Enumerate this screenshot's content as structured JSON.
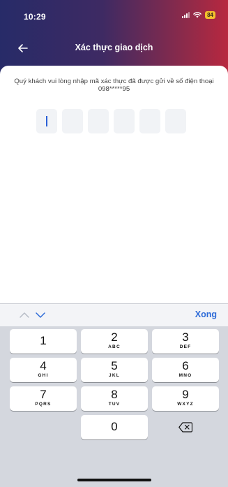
{
  "status_bar": {
    "time": "10:29",
    "battery": "84",
    "signal_icon": "signal-bars-icon",
    "wifi_icon": "wifi-icon"
  },
  "nav": {
    "title": "Xác thực giao dịch",
    "back_icon": "arrow-left-icon"
  },
  "otp": {
    "message": "Quý khách vui lòng nhập mã xác thực đã được gửi về số điện thoại 098*****95",
    "length": 6,
    "digits": [
      "",
      "",
      "",
      "",
      "",
      ""
    ]
  },
  "keyboard": {
    "done_label": "Xong",
    "keys": [
      {
        "digit": "1",
        "letters": ""
      },
      {
        "digit": "2",
        "letters": "ABC"
      },
      {
        "digit": "3",
        "letters": "DEF"
      },
      {
        "digit": "4",
        "letters": "GHI"
      },
      {
        "digit": "5",
        "letters": "JKL"
      },
      {
        "digit": "6",
        "letters": "MNO"
      },
      {
        "digit": "7",
        "letters": "PQRS"
      },
      {
        "digit": "8",
        "letters": "TUV"
      },
      {
        "digit": "9",
        "letters": "WXYZ"
      },
      {
        "digit": "0",
        "letters": ""
      }
    ],
    "delete_icon": "backspace-icon",
    "prev_icon": "chevron-up-icon",
    "next_icon": "chevron-down-icon"
  },
  "colors": {
    "accent": "#2f6cd8",
    "header_start": "#272b68",
    "header_end": "#b8283f",
    "battery": "#f3c12d"
  }
}
